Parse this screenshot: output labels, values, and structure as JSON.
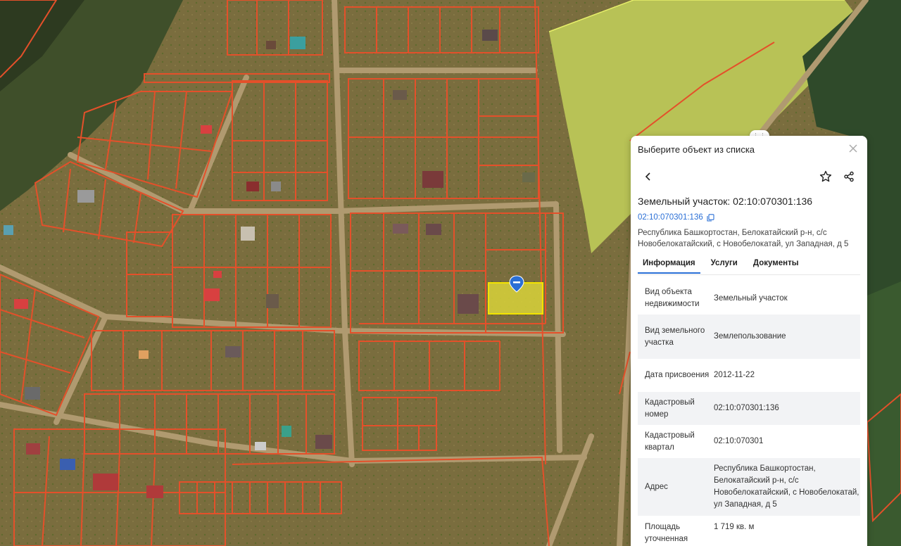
{
  "panel": {
    "header": "Выберите объект из списка",
    "title": "Земельный участок: 02:10:070301:136",
    "cadastral_link": "02:10:070301:136",
    "address": "Республика Башкортостан, Белокатайский р-н, с/с Новобелокатайский, с Новобелокатай, ул Западная, д 5",
    "tabs": [
      {
        "label": "Информация",
        "active": true
      },
      {
        "label": "Услуги",
        "active": false
      },
      {
        "label": "Документы",
        "active": false
      }
    ],
    "rows": [
      {
        "key": "Вид объекта недвижимости",
        "value": "Земельный участок"
      },
      {
        "key": "Вид земельного участка",
        "value": "Землепользование"
      },
      {
        "key": "Дата присвоения",
        "value": "2012-11-22"
      },
      {
        "key": "Кадастровый номер",
        "value": "02:10:070301:136"
      },
      {
        "key": "Кадастровый квартал",
        "value": "02:10:070301"
      },
      {
        "key": "Адрес",
        "value": "Республика Башкортостан, Белокатайский р-н, с/с Новобелокатайский, с Новобелокатай, ул Западная, д 5"
      },
      {
        "key": "Площадь уточненная",
        "value": "1 719 кв. м"
      }
    ]
  },
  "colors": {
    "parcel_border": "#e4502a",
    "selected_fill": "#e8e040",
    "selected_border": "#f2e300",
    "marker": "#2a6fd6",
    "field": "#b8c256",
    "accent": "#2a6fd6"
  },
  "icons": [
    "close-icon",
    "back-arrow-icon",
    "star-icon",
    "share-icon",
    "copy-icon",
    "map-marker-icon",
    "drag-handle-icon"
  ]
}
